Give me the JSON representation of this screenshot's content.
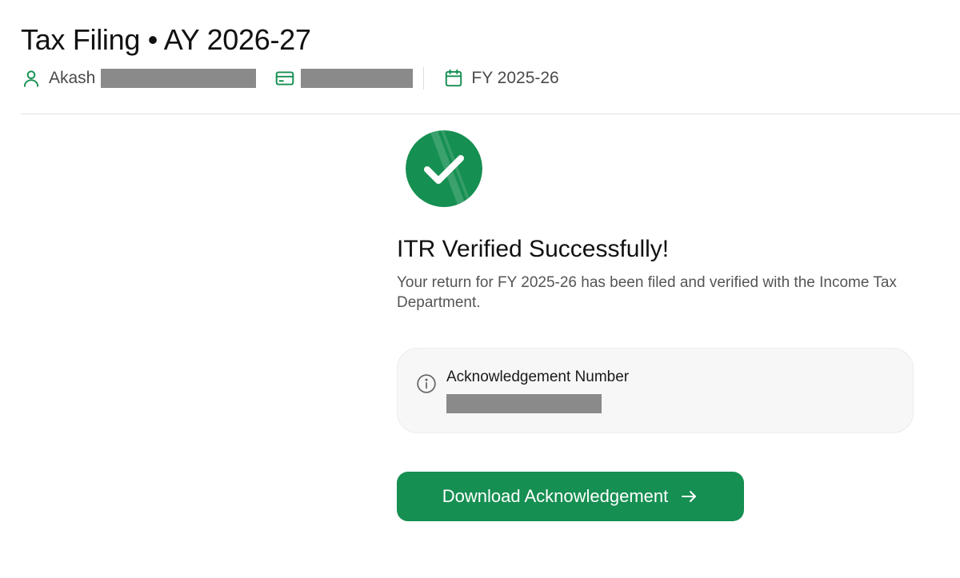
{
  "header": {
    "title": "Tax Filing • AY 2026-27",
    "user_name": "Akash",
    "financial_year": "FY 2025-26"
  },
  "status": {
    "title": "ITR Verified Successfully!",
    "description": "Your return for FY 2025-26 has been filed and verified with the Income Tax Department."
  },
  "acknowledgement": {
    "label": "Acknowledgement Number"
  },
  "actions": {
    "download_label": "Download Acknowledgement"
  },
  "icons": {
    "user": "user-icon",
    "card": "id-card-icon",
    "calendar": "calendar-icon",
    "info": "info-icon",
    "success": "check-circle-icon",
    "arrow": "arrow-right-icon"
  },
  "colors": {
    "accent": "#168f52",
    "text_primary": "#111111",
    "text_secondary": "#555555",
    "card_bg": "#f7f7f7",
    "redacted": "#8a8a8a"
  }
}
